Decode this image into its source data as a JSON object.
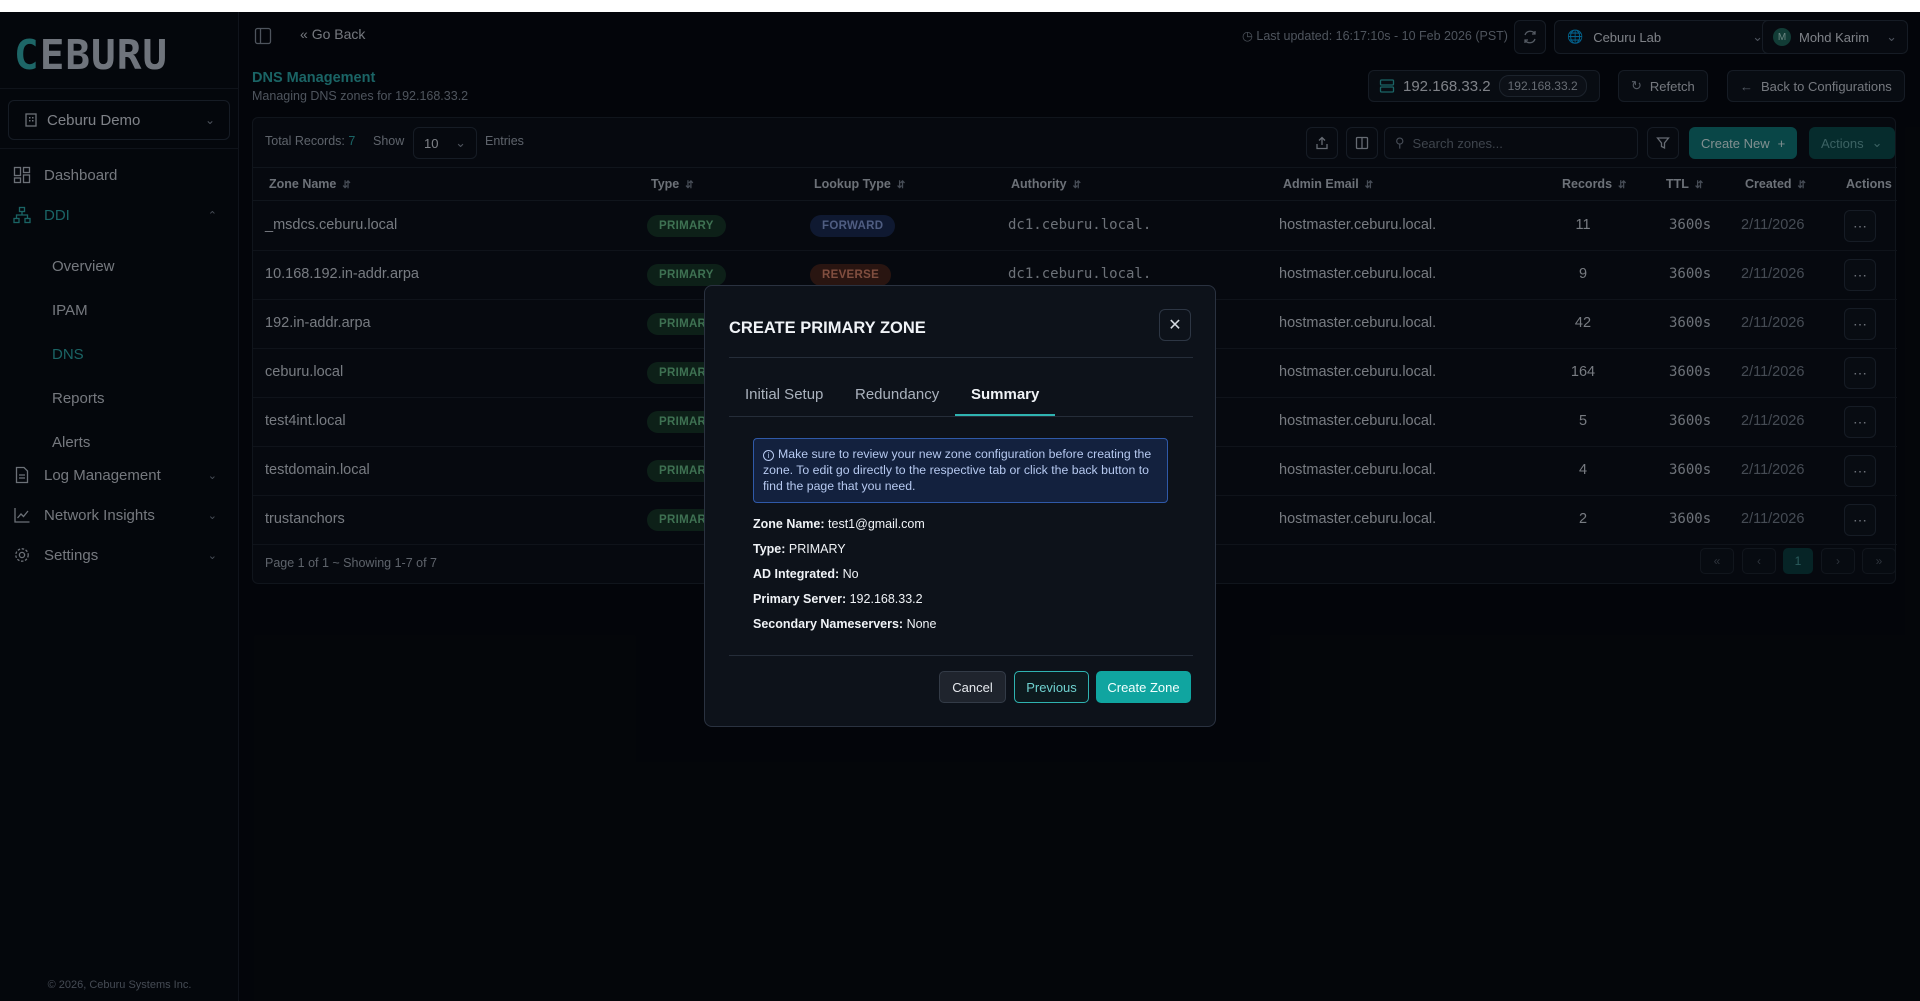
{
  "app": {
    "logo_text": "CEBURU",
    "org": "Ceburu Demo",
    "footer": "© 2026, Ceburu Systems Inc."
  },
  "nav": {
    "dashboard": "Dashboard",
    "ddi": "DDI",
    "ddi_items": [
      "Overview",
      "IPAM",
      "DNS",
      "Reports",
      "Alerts"
    ],
    "log_management": "Log Management",
    "network_insights": "Network Insights",
    "settings": "Settings"
  },
  "topbar": {
    "go_back": "Go Back",
    "last_updated": "Last updated: 16:17:10s - 10 Feb 2026 (PST)",
    "lab": "Ceburu Lab",
    "user": "Mohd Karim",
    "user_initial": "M"
  },
  "page": {
    "title": "DNS Management",
    "subtitle": "Managing DNS zones for 192.168.33.2",
    "server_ip": "192.168.33.2",
    "server_badge": "192.168.33.2",
    "refetch": "Refetch",
    "back_configs": "Back to Configurations"
  },
  "toolbar": {
    "total_label": "Total Records:",
    "total_value": "7",
    "show_label": "Show",
    "show_value": "10",
    "entries_label": "Entries",
    "search_placeholder": "Search zones...",
    "create_new": "Create New",
    "actions": "Actions"
  },
  "table": {
    "headers": [
      "Zone Name",
      "Type",
      "Lookup Type",
      "Authority",
      "Admin Email",
      "Records",
      "TTL",
      "Created",
      "Actions"
    ],
    "rows": [
      {
        "zone": "_msdcs.ceburu.local",
        "type": "PRIMARY",
        "lookup": "FORWARD",
        "authority": "dc1.ceburu.local.",
        "email": "hostmaster.ceburu.local.",
        "records": "11",
        "ttl": "3600s",
        "created": "2/11/2026"
      },
      {
        "zone": "10.168.192.in-addr.arpa",
        "type": "PRIMARY",
        "lookup": "REVERSE",
        "authority": "dc1.ceburu.local.",
        "email": "hostmaster.ceburu.local.",
        "records": "9",
        "ttl": "3600s",
        "created": "2/11/2026"
      },
      {
        "zone": "192.in-addr.arpa",
        "type": "PRIMAR",
        "lookup": "",
        "authority": "",
        "email": "hostmaster.ceburu.local.",
        "records": "42",
        "ttl": "3600s",
        "created": "2/11/2026"
      },
      {
        "zone": "ceburu.local",
        "type": "PRIMAR",
        "lookup": "",
        "authority": "",
        "email": "hostmaster.ceburu.local.",
        "records": "164",
        "ttl": "3600s",
        "created": "2/11/2026"
      },
      {
        "zone": "test4int.local",
        "type": "PRIMAR",
        "lookup": "",
        "authority": "",
        "email": "hostmaster.ceburu.local.",
        "records": "5",
        "ttl": "3600s",
        "created": "2/11/2026"
      },
      {
        "zone": "testdomain.local",
        "type": "PRIMAR",
        "lookup": "",
        "authority": "",
        "email": "hostmaster.ceburu.local.",
        "records": "4",
        "ttl": "3600s",
        "created": "2/11/2026"
      },
      {
        "zone": "trustanchors",
        "type": "PRIMAR",
        "lookup": "",
        "authority": "",
        "email": "hostmaster.ceburu.local.",
        "records": "2",
        "ttl": "3600s",
        "created": "2/11/2026"
      }
    ],
    "pagination_text": "Page 1 of 1 ~ Showing 1-7 of 7",
    "pager": [
      "«",
      "‹",
      "1",
      "›",
      "»"
    ]
  },
  "modal": {
    "title": "CREATE PRIMARY ZONE",
    "tabs": [
      "Initial Setup",
      "Redundancy",
      "Summary"
    ],
    "active_tab": "Summary",
    "info": "Make sure to review your new zone configuration before creating the zone. To edit go directly to the respective tab or click the back button to find the page that you need.",
    "summary": [
      {
        "label": "Zone Name:",
        "value": "test1@gmail.com"
      },
      {
        "label": "Type:",
        "value": "PRIMARY"
      },
      {
        "label": "AD Integrated:",
        "value": "No"
      },
      {
        "label": "Primary Server:",
        "value": "192.168.33.2"
      },
      {
        "label": "Secondary Nameservers:",
        "value": "None"
      }
    ],
    "cancel": "Cancel",
    "previous": "Previous",
    "create": "Create Zone"
  },
  "colors": {
    "accent": "#2fb3b1",
    "background": "#05070c",
    "primary_badge": "#163826",
    "forward_badge": "#1b2a52",
    "reverse_badge": "#4a2419"
  }
}
